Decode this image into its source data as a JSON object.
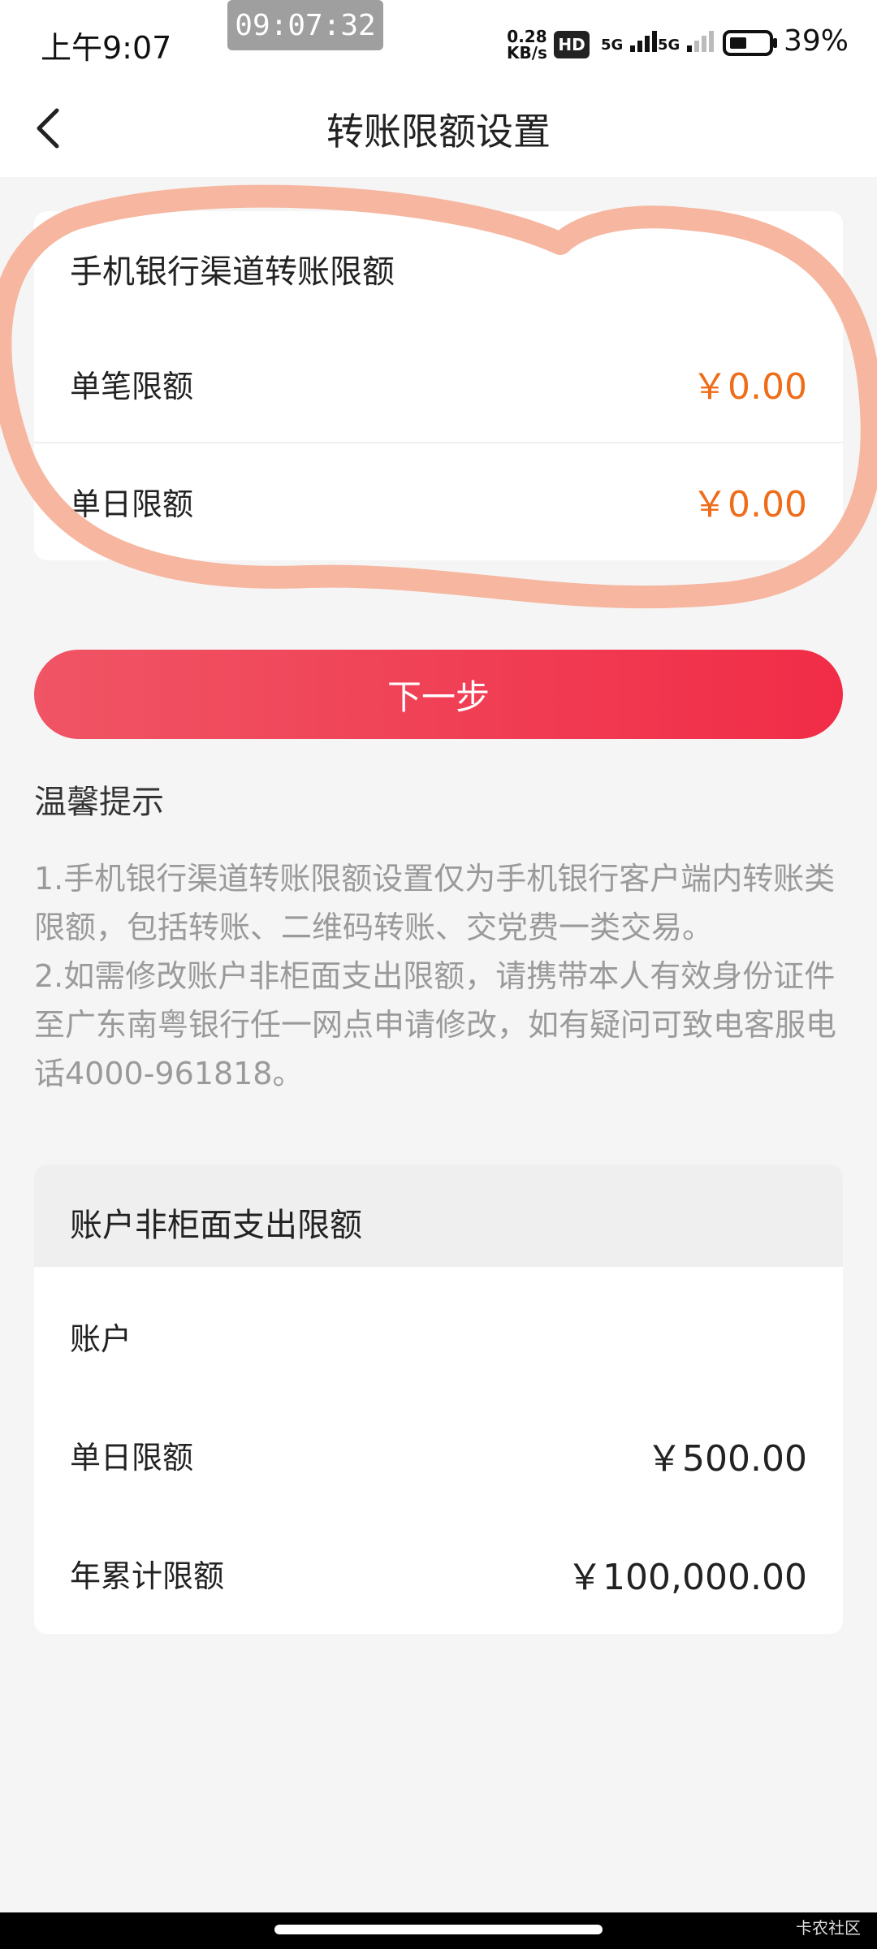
{
  "status_bar": {
    "time": "上午9:07",
    "recording_time": "09:07:32",
    "net_speed_value": "0.28",
    "net_speed_unit": "KB/s",
    "hd_badge": "HD",
    "sim1": "5G",
    "sim2": "5G",
    "battery": "39%"
  },
  "header": {
    "title": "转账限额设置",
    "back_icon": "chevron-left-icon"
  },
  "mobile_limit_card": {
    "title": "手机银行渠道转账限额",
    "rows": [
      {
        "label": "单笔限额",
        "value": "￥0.00"
      },
      {
        "label": "单日限额",
        "value": "￥0.00"
      }
    ],
    "value_color": "#ef6c19",
    "annotation_color": "#f6b29b"
  },
  "next_button": {
    "label": "下一步"
  },
  "tips": {
    "title": "温馨提示",
    "line1": "1.手机银行渠道转账限额设置仅为手机银行客户端内转账类限额，包括转账、二维码转账、交党费一类交易。",
    "line2": "2.如需修改账户非柜面支出限额，请携带本人有效身份证件至广东南粤银行任一网点申请修改，如有疑问可致电客服电话4000-961818。"
  },
  "non_counter_card": {
    "title": "账户非柜面支出限额",
    "rows": [
      {
        "label": "账户",
        "value": ""
      },
      {
        "label": "单日限额",
        "value": "￥500.00"
      },
      {
        "label": "年累计限额",
        "value": "￥100,000.00"
      }
    ]
  },
  "watermark": "卡农社区"
}
